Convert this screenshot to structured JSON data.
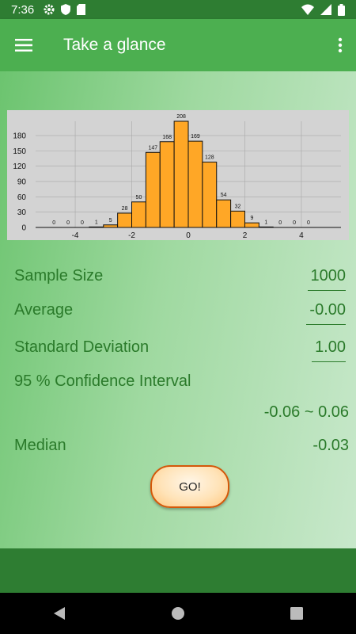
{
  "status": {
    "time": "7:36"
  },
  "app": {
    "title": "Take a glance"
  },
  "stats": {
    "sample_size_label": "Sample Size",
    "sample_size_value": "1000",
    "average_label": "Average",
    "average_value": "-0.00",
    "std_label": "Standard Deviation",
    "std_value": "1.00",
    "ci_label": "95 % Confidence Interval",
    "ci_value": "-0.06 ~ 0.06",
    "median_label": "Median",
    "median_value": "-0.03"
  },
  "go_label": "GO!",
  "colors": {
    "bar": "#ffa726",
    "status_bar": "#2e7d32",
    "app_bar": "#4caf50",
    "text": "#2a7a2a"
  },
  "chart_data": {
    "type": "bar",
    "title": "",
    "xlabel": "",
    "ylabel": "",
    "bin_edges": [
      -5,
      -4.5,
      -4,
      -3.5,
      -3,
      -2.5,
      -2,
      -1.5,
      -1,
      -0.5,
      0,
      0.5,
      1,
      1.5,
      2,
      2.5,
      3,
      3.5,
      4,
      4.5,
      5
    ],
    "values": [
      0,
      0,
      0,
      1,
      5,
      28,
      50,
      147,
      168,
      208,
      169,
      128,
      54,
      32,
      9,
      1,
      0,
      0,
      0
    ],
    "x_ticks": [
      -4,
      -2,
      0,
      2,
      4
    ],
    "y_ticks": [
      0,
      30,
      60,
      90,
      120,
      150,
      180
    ],
    "ylim": [
      0,
      208
    ],
    "xlim": [
      -5.4,
      5.4
    ],
    "grid": true
  }
}
